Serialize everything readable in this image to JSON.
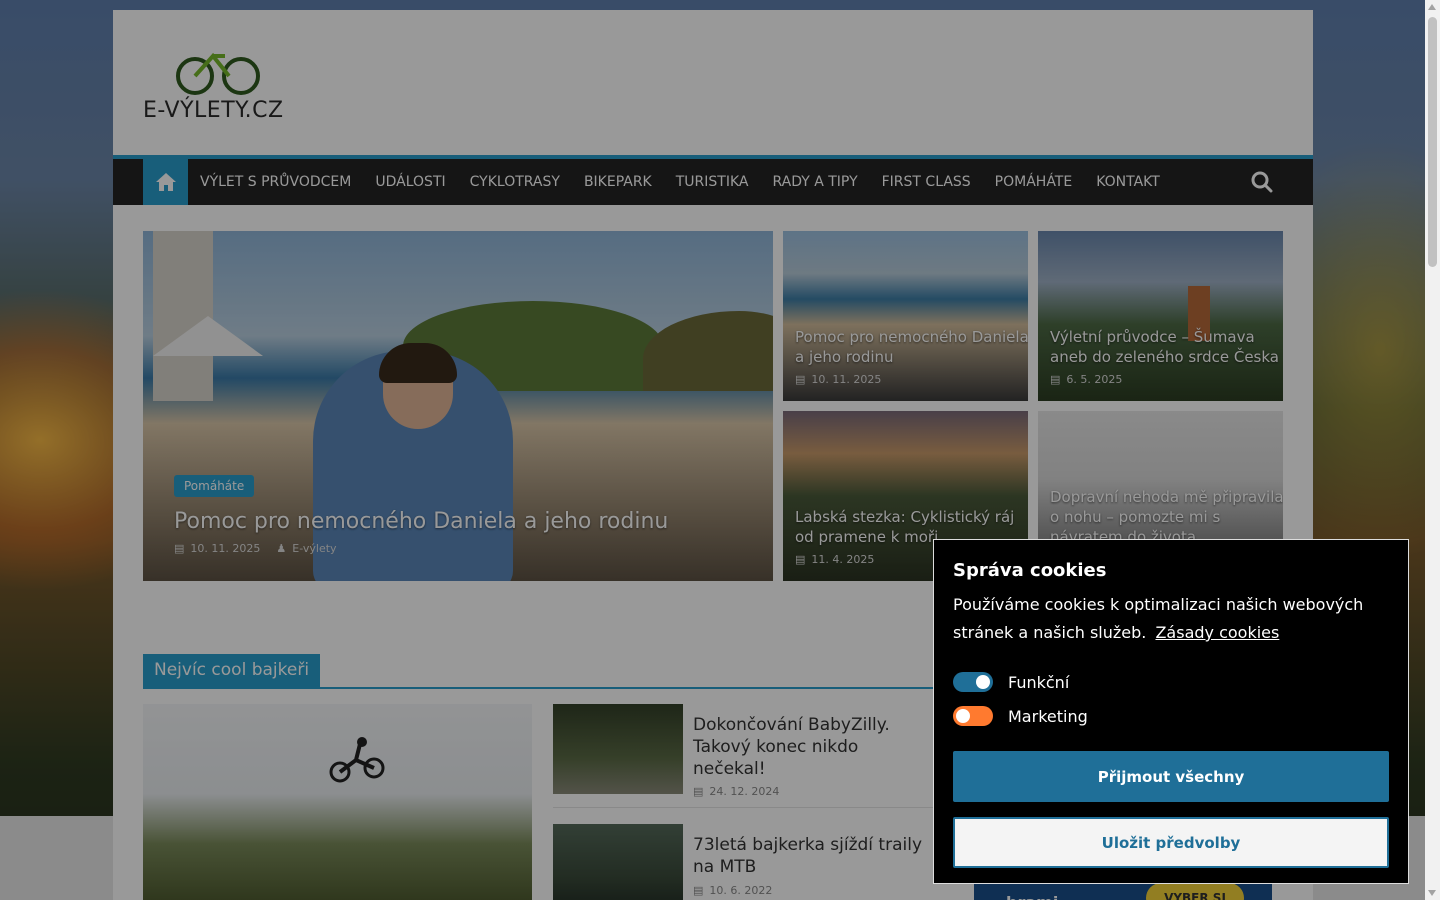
{
  "logo": {
    "text": "E-VÝLETY.CZ"
  },
  "nav": {
    "items": [
      "VÝLET S PRŮVODCEM",
      "UDÁLOSTI",
      "CYKLOTRASY",
      "BIKEPARK",
      "TURISTIKA",
      "RADY A TIPY",
      "FIRST CLASS",
      "POMÁHÁTE",
      "KONTAKT"
    ]
  },
  "featured": {
    "category": "Pomáháte",
    "title": "Pomoc pro nemocného Daniela a jeho rodinu",
    "date": "10. 11. 2025",
    "author": "E-výlety"
  },
  "tiles": [
    {
      "title": "Pomoc pro nemocného Daniela a jeho rodinu",
      "date": "10. 11. 2025"
    },
    {
      "title": "Výletní průvodce – Šumava aneb do zeleného srdce Česka",
      "date": "6. 5. 2025"
    },
    {
      "title": "Labská stezka: Cyklistický ráj od pramene k moři",
      "date": "11. 4. 2025"
    },
    {
      "title": "Dopravní nehoda mě připravila o nohu – pomozte mi s návratem do života",
      "date": ""
    }
  ],
  "section": {
    "title": "Nejvíc cool bajkeři",
    "posts": [
      {
        "title": "Dokončování BabyZilly. Takový konec nikdo nečekal!",
        "date": "24. 12. 2024"
      },
      {
        "title": "73letá bajkerka sjíždí traily na MTB",
        "date": "10. 6. 2022"
      }
    ]
  },
  "ad": {
    "text": "brami",
    "button": "VYBER SI"
  },
  "cookie": {
    "title": "Správa cookies",
    "text": "Používáme cookies k optimalizaci našich webových stránek a našich služeb.",
    "link": "Zásady cookies",
    "toggles": [
      {
        "label": "Funkční",
        "on": true
      },
      {
        "label": "Marketing",
        "on": false
      }
    ],
    "accept": "Přijmout všechny",
    "save": "Uložit předvolby"
  },
  "colors": {
    "accent": "#289dcc",
    "nav_bg": "#232323",
    "cookie_primary": "#1f6f98",
    "toggle_off": "#ff7a2f"
  }
}
